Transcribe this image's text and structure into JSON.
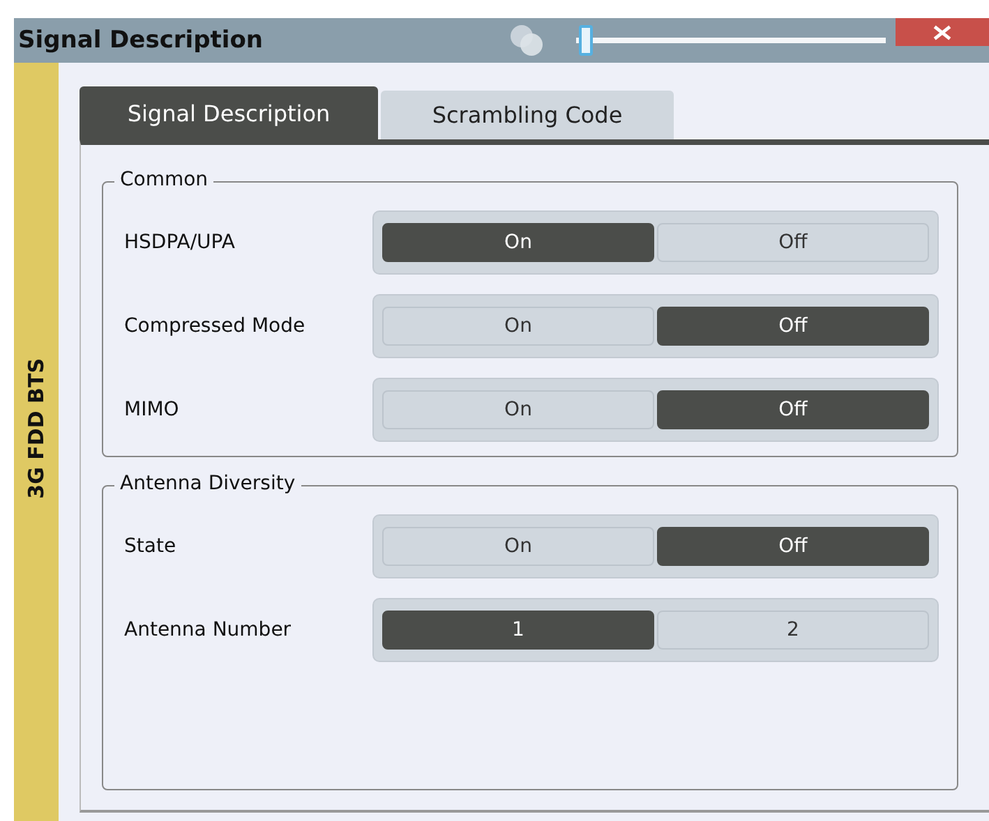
{
  "window": {
    "title": "Signal Description",
    "slider": {
      "level": 0.01
    }
  },
  "sidebar": {
    "label": "3G FDD BTS"
  },
  "tabs": [
    {
      "label": "Signal Description",
      "selected": true
    },
    {
      "label": "Scrambling Code",
      "selected": false
    }
  ],
  "groups": [
    {
      "title": "Common",
      "rows": [
        {
          "label": "HSDPA/UPA",
          "options": [
            {
              "label": "On",
              "selected": true
            },
            {
              "label": "Off",
              "selected": false
            }
          ]
        },
        {
          "label": "Compressed Mode",
          "options": [
            {
              "label": "On",
              "selected": false
            },
            {
              "label": "Off",
              "selected": true
            }
          ]
        },
        {
          "label": "MIMO",
          "options": [
            {
              "label": "On",
              "selected": false
            },
            {
              "label": "Off",
              "selected": true
            }
          ]
        }
      ]
    },
    {
      "title": "Antenna Diversity",
      "rows": [
        {
          "label": "State",
          "options": [
            {
              "label": "On",
              "selected": false
            },
            {
              "label": "Off",
              "selected": true
            }
          ]
        },
        {
          "label": "Antenna Number",
          "options": [
            {
              "label": "1",
              "selected": true
            },
            {
              "label": "2",
              "selected": false
            }
          ]
        }
      ]
    }
  ]
}
